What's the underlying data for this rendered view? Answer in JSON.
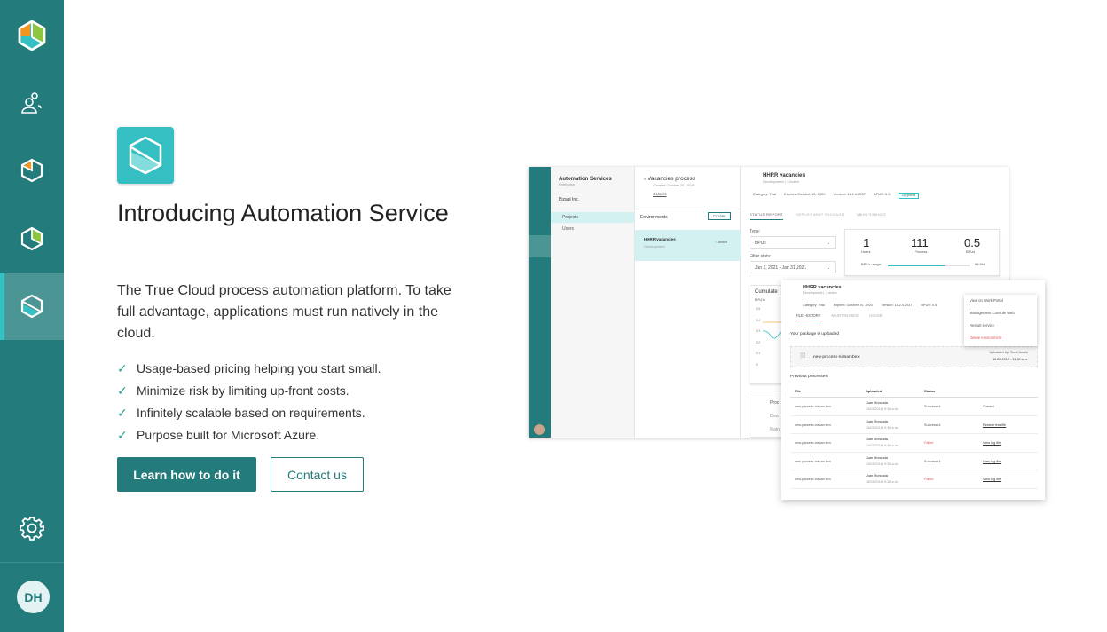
{
  "sidebar": {
    "items": [
      {
        "name": "automation-logo-icon"
      },
      {
        "name": "users-icon"
      },
      {
        "name": "process-icon"
      },
      {
        "name": "analytics-icon"
      },
      {
        "name": "automation-service-icon",
        "active": true
      }
    ],
    "settings_icon": "gear-icon",
    "avatar_initials": "DH"
  },
  "colors": {
    "sidebar": "#237b7b",
    "accent": "#35c0c4",
    "active_item": "#4b9594",
    "failed": "#e05555"
  },
  "main": {
    "title": "Introducing Automation Service",
    "description": "The True Cloud process automation platform. To take full advantage, applications must run natively in the cloud.",
    "features": [
      "Usage-based pricing helping you start small.",
      "Minimize risk by limiting up-front costs.",
      "Infinitely scalable based on requirements.",
      "Purpose built for Microsoft Azure."
    ],
    "primary_button": "Learn how to do it",
    "secondary_button": "Contact us"
  },
  "preview": {
    "nav_title": "Automation Services",
    "nav_sub": "Enterprise",
    "org": "Bizagi Inc.",
    "nav_items": [
      "Projects",
      "Users"
    ],
    "process_title": "Vacancies process",
    "process_created": "Created October 20, 2018",
    "process_users": "4 Users",
    "environments_label": "Environments",
    "create_label": "Create",
    "env_name": "HHRR vacancies",
    "env_type": "Development",
    "env_status": "Active",
    "detail_title": "HHRR vacancies",
    "detail_sub": "Development",
    "detail_status": "Active",
    "category": "Category: Trial",
    "expires": "Expires: October 20, 2020",
    "version": "Version: 11.2.4.2037",
    "bpus": "BPUS: 0.5",
    "upgrade": "Upgrade",
    "tabs": [
      "STATUS REPORT",
      "DEPLOYMENT PACKAGE",
      "MAINTENANCE"
    ],
    "type_label": "Type:",
    "type_value": "BPUs",
    "filter_label": "Filter stats:",
    "filter_value": "Jan 1, 2021 - Jan 31,2021",
    "stats": [
      {
        "value": "1",
        "label": "Users"
      },
      {
        "value": "111",
        "label": "Process"
      },
      {
        "value": "0.5",
        "label": "BPUs"
      }
    ],
    "usage_label": "BPUs usage",
    "usage_value": "98.9%",
    "usage_fraction": 0.7,
    "chart_title": "Cumulate",
    "chart_ylabel": "BPU's",
    "chart_ticks": [
      "0.5",
      "0.4",
      "0.3",
      "0.2",
      "0.1",
      "0"
    ],
    "process_col": "Proc",
    "process_rows": [
      "Dow",
      "Main"
    ],
    "overlay": {
      "title": "HHRR vacancies",
      "sub": "Development",
      "status": "active",
      "category": "Category: Trial",
      "expires": "Expires: October 20, 2020",
      "version": "Version: 11.2.4.2037",
      "bpus": "BPUS: 0.5",
      "tabs": [
        "FILE HISTORY",
        "MAINTENANCE",
        "USAGE"
      ],
      "uploaded_heading": "Your package is uploaded",
      "file_name": "new-process-nissan.bex",
      "uploaded_by": "Uploaded by: Scott Austin",
      "uploaded_at": "11.20.2019 - 11:30 a.m.",
      "previous_heading": "Previous processes",
      "columns": [
        "File",
        "Uploaded",
        "Status",
        ""
      ],
      "rows": [
        {
          "file": "new-process-nissan.bex",
          "user": "Juan Moncada",
          "date": "14/03/2018, 9:36 a.m.",
          "status": "Successful",
          "action": "Current"
        },
        {
          "file": "new-process-nissan.bex",
          "user": "Juan Moncada",
          "date": "14/03/2018, 9:36 a.m.",
          "status": "Successful",
          "action": "Restore this file"
        },
        {
          "file": "new-process-nissan.bex",
          "user": "Juan Moncada",
          "date": "14/03/2018, 9:36 a.m.",
          "status": "Failed",
          "action": "View log file"
        },
        {
          "file": "new-process-nissan.bex",
          "user": "Juan Moncada",
          "date": "14/03/2018, 9:36 a.m.",
          "status": "Successful",
          "action": "View log file"
        },
        {
          "file": "new-process-nissan.bex",
          "user": "Juan Moncada",
          "date": "14/03/2018, 9:36 a.m.",
          "status": "Failed",
          "action": "View log file"
        }
      ],
      "menu": [
        "View on Work Portal",
        "Management Console Web",
        "Restart service",
        "Delete environment"
      ]
    }
  }
}
